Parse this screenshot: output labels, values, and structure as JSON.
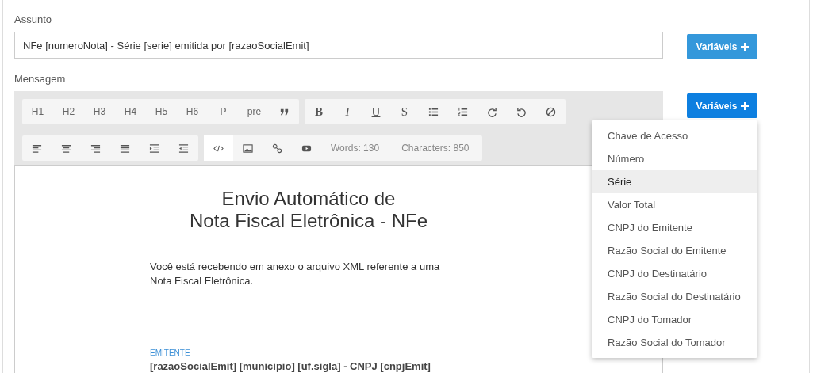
{
  "subject": {
    "label": "Assunto",
    "value": "NFe [numeroNota] - Série [serie] emitida por [razaoSocialEmit]",
    "button": "Variáveis"
  },
  "message": {
    "label": "Mensagem",
    "button": "Variáveis",
    "button_open": true
  },
  "toolbar": [
    [
      {
        "items": [
          {
            "kind": "text",
            "label": "H1"
          },
          {
            "kind": "text",
            "label": "H2"
          },
          {
            "kind": "text",
            "label": "H3"
          },
          {
            "kind": "text",
            "label": "H4"
          },
          {
            "kind": "text",
            "label": "H5"
          },
          {
            "kind": "text",
            "label": "H6"
          },
          {
            "kind": "text",
            "label": "P"
          },
          {
            "kind": "text",
            "label": "pre"
          },
          {
            "kind": "icon"
          }
        ]
      },
      {
        "items": [
          {
            "kind": "bold",
            "label": "B"
          },
          {
            "kind": "italic",
            "label": "I"
          },
          {
            "kind": "underline",
            "label": "U"
          },
          {
            "kind": "strike",
            "label": "S"
          },
          {
            "kind": "icon"
          },
          {
            "kind": "icon"
          },
          {
            "kind": "icon"
          },
          {
            "kind": "icon"
          },
          {
            "kind": "icon"
          }
        ]
      }
    ],
    [
      {
        "items": [
          {
            "kind": "icon"
          },
          {
            "kind": "icon"
          },
          {
            "kind": "icon"
          },
          {
            "kind": "icon"
          },
          {
            "kind": "icon"
          },
          {
            "kind": "icon"
          }
        ]
      },
      {
        "items": [
          {
            "kind": "icon",
            "on": true
          },
          {
            "kind": "icon"
          },
          {
            "kind": "icon"
          },
          {
            "kind": "icon"
          },
          {
            "kind": "counter",
            "label": "Words: 130"
          },
          {
            "kind": "counter",
            "label": "Characters: 850"
          }
        ]
      }
    ]
  ],
  "content": {
    "title": [
      "Envio Automático de",
      "Nota Fiscal Eletrônica - NFe"
    ],
    "paragraph": "Você está recebendo em anexo o arquivo XML referente a uma Nota Fiscal Eletrônica.",
    "section_label": "EMITENTE",
    "section_value": "[razaoSocialEmit] [municipio] [uf.sigla] - CNPJ [cnpjEmit]"
  },
  "variables_menu": [
    {
      "label": "Chave de Acesso",
      "selected": false
    },
    {
      "label": "Número",
      "selected": false
    },
    {
      "label": "Série",
      "selected": true
    },
    {
      "label": "Valor Total",
      "selected": false
    },
    {
      "label": "CNPJ do Emitente",
      "selected": false
    },
    {
      "label": "Razão Social do Emitente",
      "selected": false
    },
    {
      "label": "CNPJ do Destinatário",
      "selected": false
    },
    {
      "label": "Razão Social do Destinatário",
      "selected": false
    },
    {
      "label": "CNPJ do Tomador",
      "selected": false
    },
    {
      "label": "Razão Social do Tomador",
      "selected": false
    }
  ]
}
